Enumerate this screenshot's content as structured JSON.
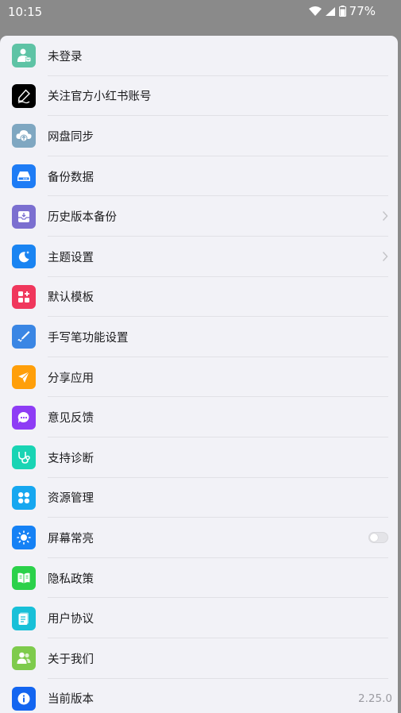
{
  "status_bar": {
    "time": "10:15",
    "battery": "77%"
  },
  "menu": {
    "items": [
      {
        "label": "未登录",
        "icon": "user-icon",
        "color": "#5ec3a5"
      },
      {
        "label": "关注官方小红书账号",
        "icon": "pen-icon",
        "color": "#000000"
      },
      {
        "label": "网盘同步",
        "icon": "cloud-sync-icon",
        "color": "#7fa7c1"
      },
      {
        "label": "备份数据",
        "icon": "drive-icon",
        "color": "#1e7cf5"
      },
      {
        "label": "历史版本备份",
        "icon": "history-box-icon",
        "color": "#7b6fd0"
      },
      {
        "label": "主题设置",
        "icon": "moon-icon",
        "color": "#1a84f2"
      },
      {
        "label": "默认模板",
        "icon": "template-grid-icon",
        "color": "#f0375c"
      },
      {
        "label": "手写笔功能设置",
        "icon": "stylus-icon",
        "color": "#3a86e4"
      },
      {
        "label": "分享应用",
        "icon": "share-send-icon",
        "color": "#ff9f0a"
      },
      {
        "label": "意见反馈",
        "icon": "feedback-chat-icon",
        "color": "#8e3cf5"
      },
      {
        "label": "支持诊断",
        "icon": "stethoscope-icon",
        "color": "#19d4b4"
      },
      {
        "label": "资源管理",
        "icon": "resource-grid-icon",
        "color": "#16a7f0"
      },
      {
        "label": "屏幕常亮",
        "icon": "sun-icon",
        "color": "#1581f5"
      },
      {
        "label": "隐私政策",
        "icon": "book-icon",
        "color": "#2bd14a"
      },
      {
        "label": "用户协议",
        "icon": "document-icon",
        "color": "#18c0d8"
      },
      {
        "label": "关于我们",
        "icon": "people-icon",
        "color": "#7ecb4c"
      },
      {
        "label": "当前版本",
        "icon": "info-icon",
        "color": "#1365f0"
      }
    ],
    "screen_on_enabled": false,
    "version_value": "2.25.0"
  }
}
